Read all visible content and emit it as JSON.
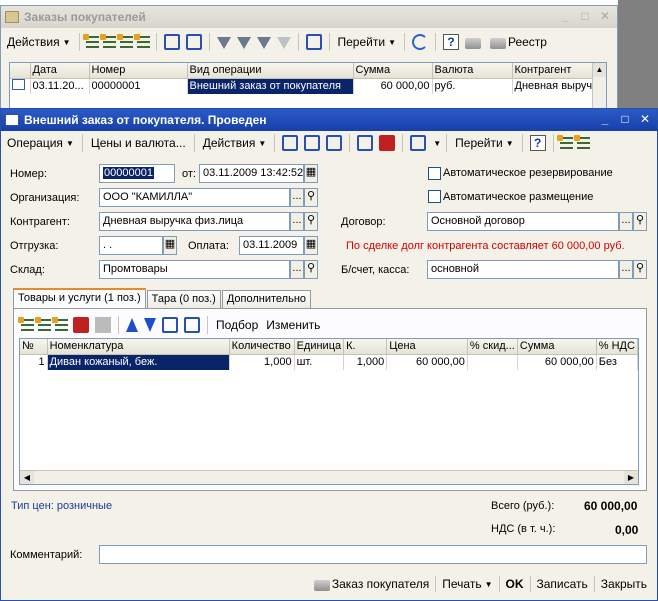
{
  "colors": {
    "selection": "#0a246a",
    "title_active": "#1740a8",
    "debt_warning": "#d00000",
    "link_blue": "#1a3a9a"
  },
  "list_window": {
    "title": "Заказы покупателей",
    "toolbar": {
      "actions": "Действия",
      "goto": "Перейти",
      "registry": "Реестр"
    },
    "columns": [
      "Дата",
      "Номер",
      "Вид операции",
      "Сумма",
      "Валюта",
      "Контрагент"
    ],
    "rows": [
      {
        "date": "03.11.20...",
        "number": "00000001",
        "operation": "Внешний заказ от покупателя",
        "sum": "60 000,00",
        "currency": "руб.",
        "counterparty": "Дневная выруч"
      }
    ]
  },
  "doc_window": {
    "title": "Внешний заказ от покупателя. Проведен",
    "toolbar": {
      "operation": "Операция",
      "prices": "Цены и валюта...",
      "actions": "Действия",
      "goto": "Перейти"
    },
    "labels": {
      "number": "Номер:",
      "from": "от:",
      "organization": "Организация:",
      "counterparty": "Контрагент:",
      "shipment": "Отгрузка:",
      "payment": "Оплата:",
      "warehouse": "Склад:",
      "contract": "Договор:",
      "account": "Б/счет, касса:",
      "auto_reserve": "Автоматическое резервирование",
      "auto_place": "Автоматическое размещение"
    },
    "fields": {
      "number": "00000001",
      "date": "03.11.2009 13:42:52",
      "organization": "ООО \"КАМИЛЛА\"",
      "counterparty": "Дневная выручка физ.лица",
      "shipment": " .  .",
      "payment": "03.11.2009",
      "warehouse": "Промтовары",
      "contract": "Основной договор",
      "account": "основной"
    },
    "debt_message": "По сделке долг контрагента составляет 60 000,00 руб.",
    "tabs": [
      "Товары и услуги (1 поз.)",
      "Тара (0 поз.)",
      "Дополнительно"
    ],
    "items_toolbar": {
      "select": "Подбор",
      "edit": "Изменить"
    },
    "item_columns": [
      "№",
      "Номенклатура",
      "Количество",
      "Единица",
      "К.",
      "Цена",
      "% скид...",
      "Сумма",
      "% НДС"
    ],
    "items": [
      {
        "n": "1",
        "name": "Диван кожаный, беж.",
        "qty": "1,000",
        "unit": "шт.",
        "k": "1,000",
        "price": "60 000,00",
        "discount": "",
        "sum": "60 000,00",
        "vat": "Без"
      }
    ],
    "price_type": "Тип цен: розничные",
    "total_label": "Всего (руб.):",
    "total_value": "60 000,00",
    "vat_label": "НДС (в т. ч.):",
    "vat_value": "0,00",
    "comment_label": "Комментарий:",
    "bottom": {
      "order": "Заказ покупателя",
      "print": "Печать",
      "ok": "OK",
      "save": "Записать",
      "close": "Закрыть"
    }
  }
}
